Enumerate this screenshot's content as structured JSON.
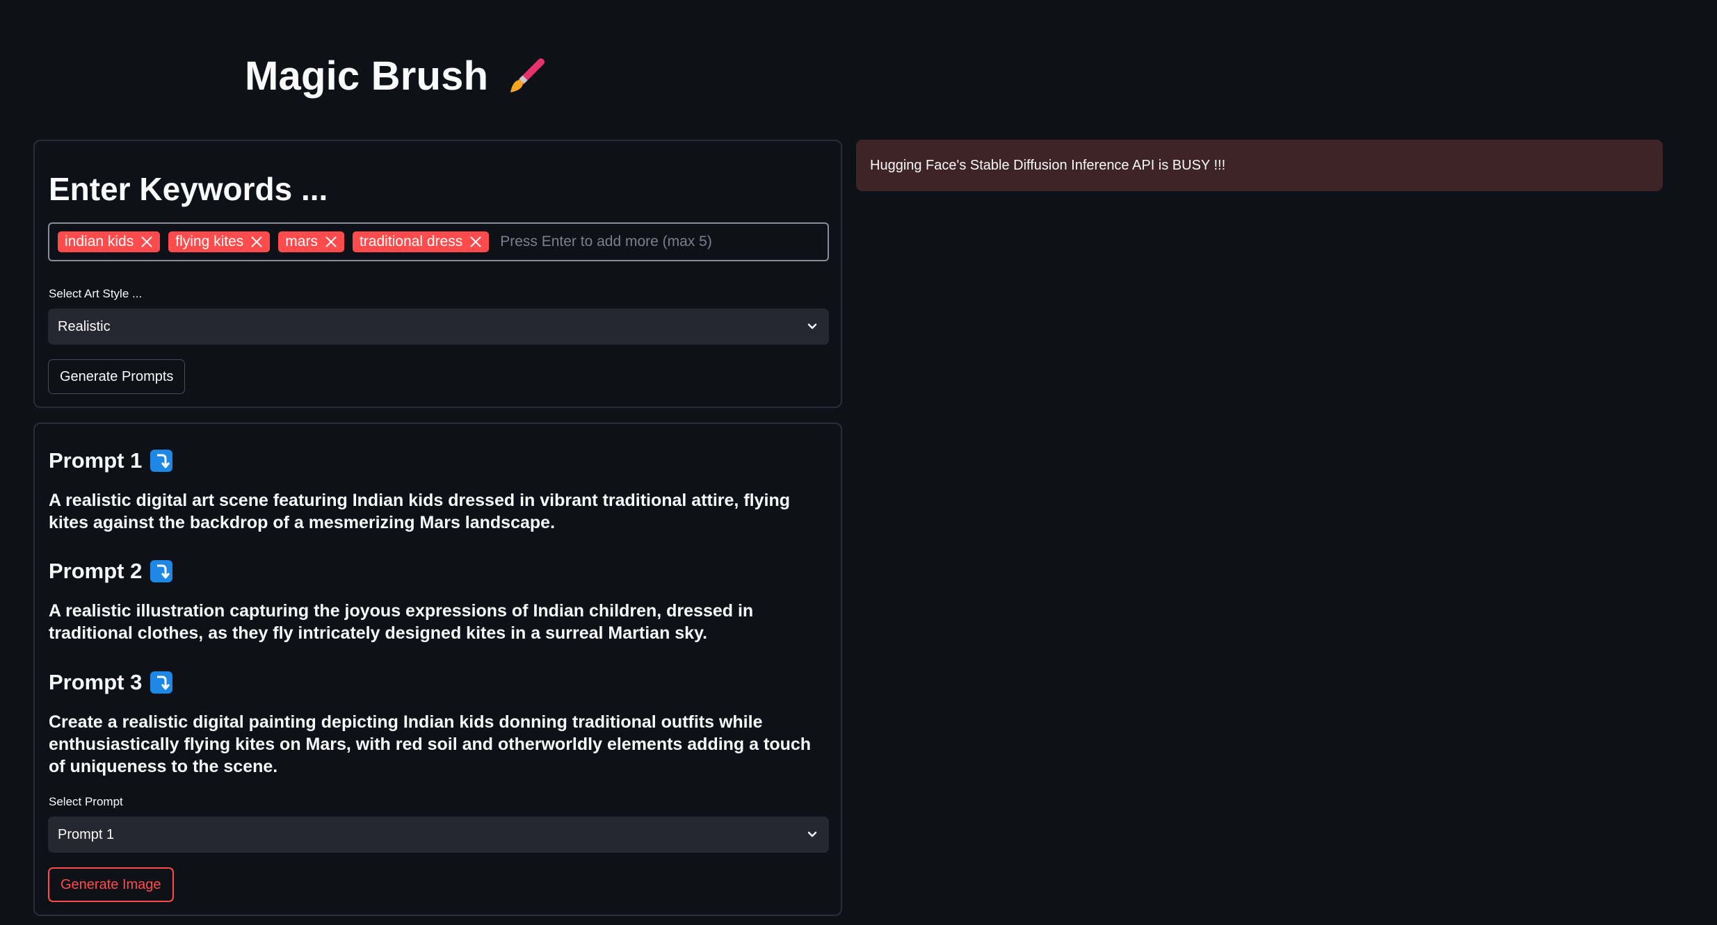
{
  "app": {
    "title": "Magic Brush",
    "title_icon": "paintbrush-icon"
  },
  "keywords_card": {
    "heading": "Enter Keywords ...",
    "tags": [
      "indian kids",
      "flying kites",
      "mars",
      "traditional dress"
    ],
    "tag_placeholder": "Press Enter to add more (max 5)",
    "tag_color": "#ff4b4b",
    "art_style_label": "Select Art Style ...",
    "art_style_value": "Realistic",
    "generate_prompts_label": "Generate Prompts"
  },
  "prompts_card": {
    "heading_icon": "arrow-down-right-icon",
    "prompts": [
      {
        "title": "Prompt 1",
        "text": "A realistic digital art scene featuring Indian kids dressed in vibrant traditional attire, flying kites against the backdrop of a mesmerizing Mars landscape."
      },
      {
        "title": "Prompt 2",
        "text": "A realistic illustration capturing the joyous expressions of Indian children, dressed in traditional clothes, as they fly intricately designed kites in a surreal Martian sky."
      },
      {
        "title": "Prompt 3",
        "text": "Create a realistic digital painting depicting Indian kids donning traditional outfits while enthusiastically flying kites on Mars, with red soil and otherworldly elements adding a touch of uniqueness to the scene."
      }
    ],
    "select_prompt_label": "Select Prompt",
    "select_prompt_value": "Prompt 1",
    "generate_image_label": "Generate Image",
    "accent_color": "#ff4b4b"
  },
  "alert": {
    "message": "Hugging Face's Stable Diffusion Inference API is BUSY !!!",
    "background": "#3e2327"
  }
}
